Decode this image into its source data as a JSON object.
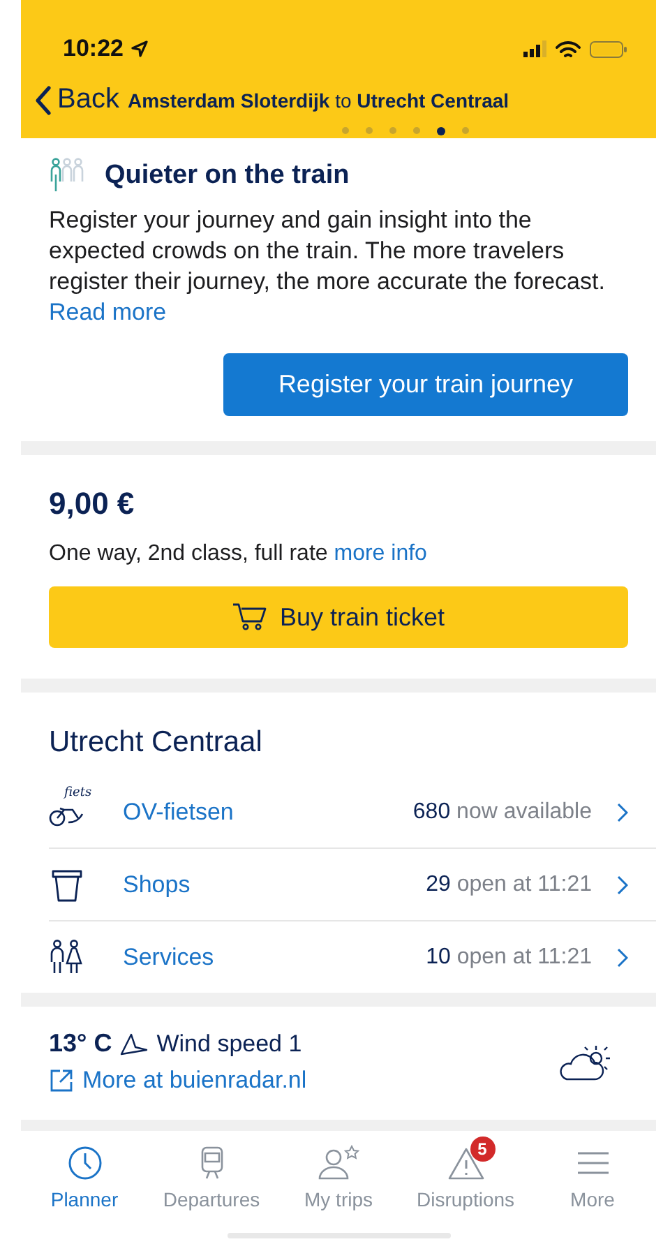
{
  "status_bar": {
    "time": "10:22"
  },
  "nav": {
    "back": "Back",
    "origin": "Amsterdam Sloterdijk",
    "joiner": "to",
    "destination": "Utrecht Centraal",
    "pages": [
      {
        "selected": false
      },
      {
        "selected": false
      },
      {
        "selected": false
      },
      {
        "selected": false
      },
      {
        "selected": true
      },
      {
        "selected": false
      }
    ]
  },
  "crowd_card": {
    "title": "Quieter on the train",
    "body": "Register your journey and gain insight into the expected crowds on the train. The more travelers register their journey, the more accurate the forecast.",
    "link": "Read more",
    "button": "Register your train journey"
  },
  "price_card": {
    "price": "9,00 €",
    "description": "One way, 2nd class, full rate",
    "link": "more info",
    "button": "Buy train ticket"
  },
  "station": {
    "title": "Utrecht Centraal",
    "rows": [
      {
        "kind": "bike",
        "icon_text": "fiets",
        "label": "OV-fietsen",
        "count": "680",
        "detail": "now available"
      },
      {
        "kind": "shop",
        "label": "Shops",
        "count": "29",
        "detail": "open at 11:21"
      },
      {
        "kind": "service",
        "label": "Services",
        "count": "10",
        "detail": "open at 11:21"
      }
    ]
  },
  "weather": {
    "temperature": "13° C",
    "wind": "Wind speed 1",
    "link": "More at buienradar.nl"
  },
  "tab_bar": [
    {
      "kind": "clock",
      "label": "Planner",
      "selected": true
    },
    {
      "kind": "train",
      "label": "Departures",
      "selected": false
    },
    {
      "kind": "person",
      "label": "My trips",
      "selected": false
    },
    {
      "kind": "warning",
      "label": "Disruptions",
      "selected": false,
      "badge": "5"
    },
    {
      "kind": "menu",
      "label": "More",
      "selected": false
    }
  ]
}
